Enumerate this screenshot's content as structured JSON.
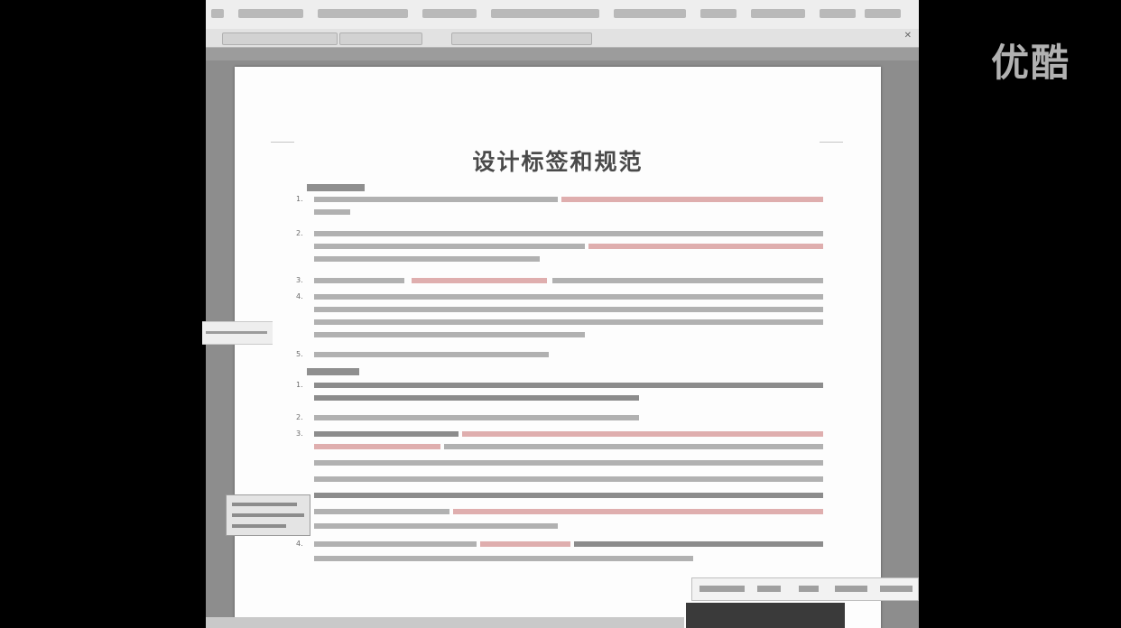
{
  "document": {
    "title": "设计标签和规范"
  },
  "watermark": {
    "text": "优酷"
  },
  "icons": {
    "tab_close": "close-icon"
  }
}
